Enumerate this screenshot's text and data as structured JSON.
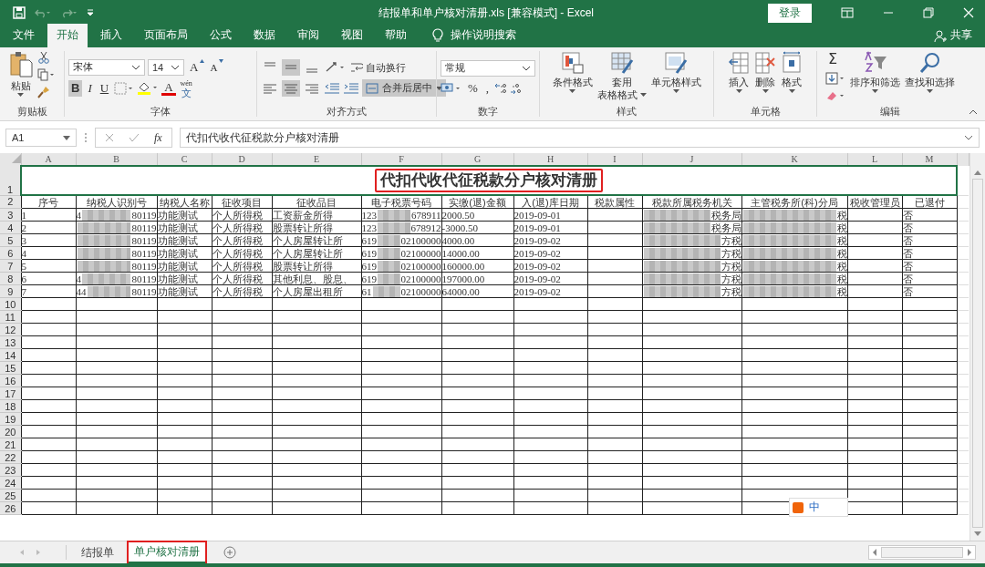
{
  "title_bar": {
    "title": "结报单和单户核对清册.xls  [兼容模式]  -  Excel",
    "sign_in": "登录"
  },
  "ribbon_tabs": [
    {
      "label": "文件",
      "selected": false
    },
    {
      "label": "开始",
      "selected": true
    },
    {
      "label": "插入",
      "selected": false
    },
    {
      "label": "页面布局",
      "selected": false
    },
    {
      "label": "公式",
      "selected": false
    },
    {
      "label": "数据",
      "selected": false
    },
    {
      "label": "审阅",
      "selected": false
    },
    {
      "label": "视图",
      "selected": false
    },
    {
      "label": "帮助",
      "selected": false
    }
  ],
  "tell_me": "操作说明搜索",
  "share": "共享",
  "ribbon": {
    "clipboard": {
      "label": "剪贴板",
      "paste": "粘贴"
    },
    "font": {
      "label": "字体",
      "font_name": "宋体",
      "font_size": "14",
      "grow": "A",
      "shrink": "A",
      "bold": "B",
      "bold_on": true,
      "italic": "I",
      "underline": "U",
      "font_color": "A",
      "phonetic_top": "wén",
      "phonetic_bottom": "文"
    },
    "alignment": {
      "label": "对齐方式",
      "middle_on": true,
      "center_on": true,
      "wrap_text": "自动换行",
      "merge_center": "合并后居中",
      "merge_on": true
    },
    "number": {
      "label": "数字",
      "format": "常规",
      "percent": "%",
      "comma": ","
    },
    "styles": {
      "label": "样式",
      "conditional": "条件格式",
      "table_top": "套用",
      "table_bottom": "表格格式",
      "cell_styles": "单元格样式"
    },
    "cells": {
      "label": "单元格",
      "insert": "插入",
      "delete": "删除",
      "format": "格式"
    },
    "editing": {
      "label": "编辑",
      "autosum": "Σ",
      "sort": "排序和筛选",
      "find": "查找和选择"
    }
  },
  "formula_bar": {
    "name_box": "A1",
    "fx": "fx",
    "formula": "代扣代收代征税款分户核对清册"
  },
  "sheet": {
    "columns": [
      "A",
      "B",
      "C",
      "D",
      "E",
      "F",
      "G",
      "H",
      "I",
      "J",
      "K",
      "L",
      "M"
    ],
    "title": {
      "row": "1",
      "text": "代扣代收代征税款分户核对清册",
      "selected": true,
      "highlighted": true
    },
    "header_row": {
      "row": "2",
      "cells": [
        "序号",
        "纳税人识别号",
        "纳税人名称",
        "征收项目",
        "征收品目",
        "电子税票号码",
        "实缴(退)金额",
        "入(退)库日期",
        "税款属性",
        "税款所属税务机关",
        "主管税务所(科)分局",
        "税收管理员",
        "已退付"
      ]
    },
    "rows": [
      {
        "row": "3",
        "cells": {
          "A": "1",
          "B": {
            "before": "4",
            "after": "80119"
          },
          "C": "功能测试",
          "D": "个人所得税",
          "E": "工资薪金所得",
          "F": {
            "before": "123",
            "after": "678911"
          },
          "G": "2000.50",
          "H": "2019-09-01",
          "J": {
            "after": "税务局"
          },
          "K": {
            "after": "税"
          },
          "M": "否"
        }
      },
      {
        "row": "4",
        "cells": {
          "A": "2",
          "B": {
            "after": "80119"
          },
          "C": "功能测试",
          "D": "个人所得税",
          "E": "股票转让所得",
          "F": {
            "before": "123",
            "after": "678912"
          },
          "G": "-3000.50",
          "H": "2019-09-01",
          "J": {
            "after": "税务局"
          },
          "K": {
            "after": "税"
          },
          "M": "否"
        }
      },
      {
        "row": "5",
        "cells": {
          "A": "3",
          "B": {
            "after": "80119"
          },
          "C": "功能测试",
          "D": "个人所得税",
          "E": "个人房屋转让所",
          "F": {
            "before": "619",
            "after": "02100000"
          },
          "G": "4000.00",
          "H": "2019-09-02",
          "J": {
            "after": "方税"
          },
          "K": {
            "after": "税"
          },
          "M": "否"
        }
      },
      {
        "row": "6",
        "cells": {
          "A": "4",
          "B": {
            "after": "80119"
          },
          "C": "功能测试",
          "D": "个人所得税",
          "E": "个人房屋转让所",
          "F": {
            "before": "619",
            "after": "02100000"
          },
          "G": "14000.00",
          "H": "2019-09-02",
          "J": {
            "after": "方税"
          },
          "K": {
            "after": "税"
          },
          "M": "否"
        }
      },
      {
        "row": "7",
        "cells": {
          "A": "5",
          "B": {
            "after": "80119"
          },
          "C": "功能测试",
          "D": "个人所得税",
          "E": "股票转让所得",
          "F": {
            "before": "619",
            "after": "02100000"
          },
          "G": "160000.00",
          "H": "2019-09-02",
          "J": {
            "after": "方税"
          },
          "K": {
            "after": "税"
          },
          "M": "否"
        }
      },
      {
        "row": "8",
        "cells": {
          "A": "6",
          "B": {
            "before": "4",
            "after": "80119"
          },
          "C": "功能测试",
          "D": "个人所得税",
          "E": "其他利息、股息、",
          "F": {
            "before": "619",
            "after": "02100000"
          },
          "G": "197000.00",
          "H": "2019-09-02",
          "J": {
            "after": "方税"
          },
          "K": {
            "after": "税"
          },
          "M": "否"
        }
      },
      {
        "row": "9",
        "cells": {
          "A": "7",
          "B": {
            "before": "44",
            "after": "80119"
          },
          "C": "功能测试",
          "D": "个人所得税",
          "E": "个人房屋出租所",
          "F": {
            "before": "61",
            "after": "02100000"
          },
          "G": "64000.00",
          "H": "2019-09-02",
          "J": {
            "after": "方税"
          },
          "K": {
            "after": "税"
          },
          "M": "否"
        }
      }
    ],
    "empty_rows": [
      "10",
      "11",
      "12",
      "13",
      "14",
      "15",
      "16",
      "17",
      "18",
      "19",
      "20",
      "21",
      "22",
      "23",
      "24",
      "25",
      "26"
    ]
  },
  "ime_bar": {
    "mode": "中"
  },
  "sheet_tabs": [
    {
      "label": "结报单",
      "selected": false,
      "highlighted": false
    },
    {
      "label": "单户核对清册",
      "selected": true,
      "highlighted": true
    }
  ]
}
